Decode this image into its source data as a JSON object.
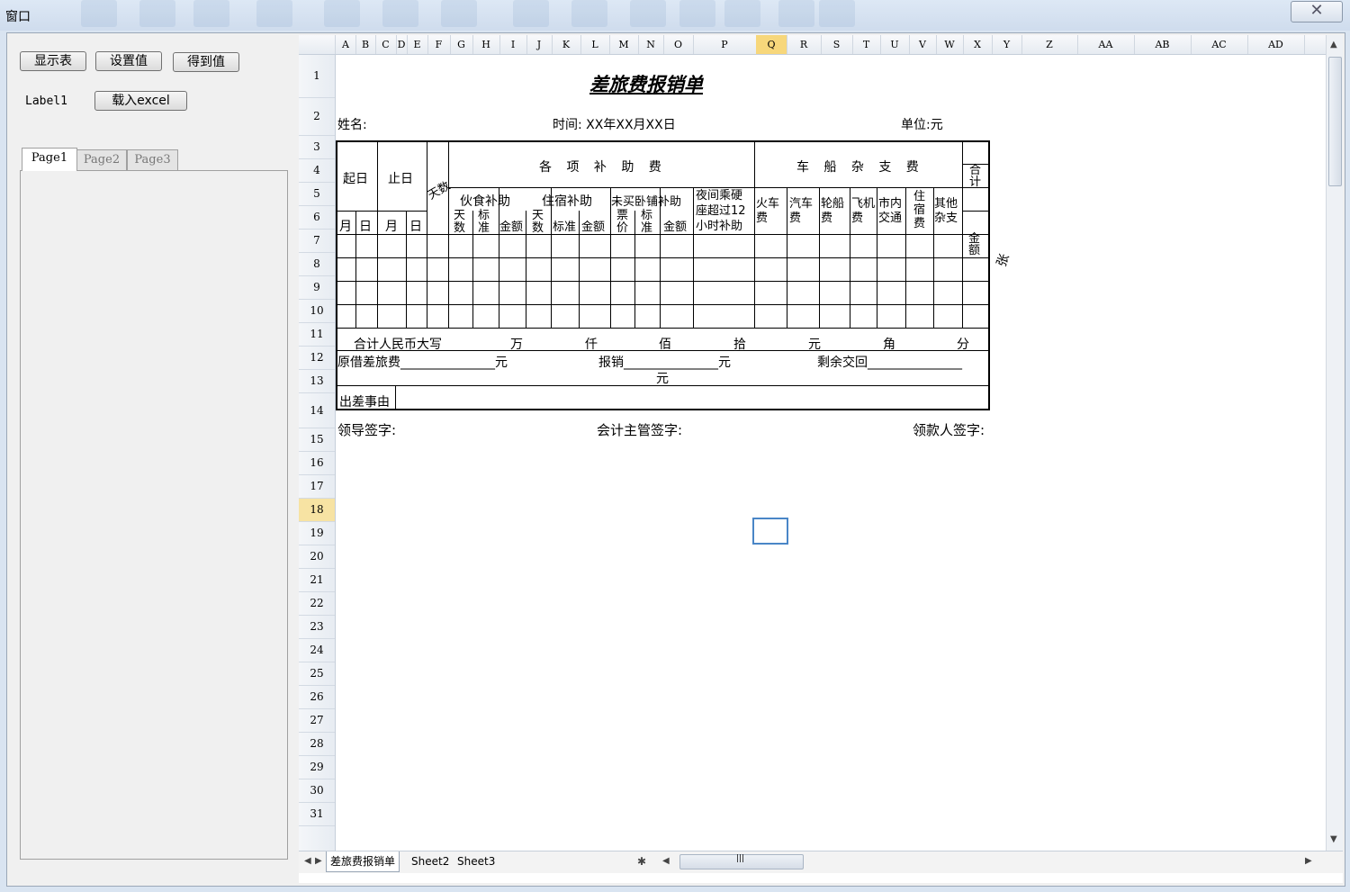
{
  "window": {
    "title": "窗口",
    "close_symbol": "✕"
  },
  "toolbar": {
    "show_table": "显示表",
    "set_value": "设置值",
    "get_value": "得到值",
    "label1": "Label1",
    "load_excel": "载入excel"
  },
  "tabs": [
    "Page1",
    "Page2",
    "Page3"
  ],
  "spreadsheet": {
    "columns": [
      "A",
      "B",
      "C",
      "D",
      "E",
      "F",
      "G",
      "H",
      "I",
      "J",
      "K",
      "L",
      "M",
      "N",
      "O",
      "P",
      "Q",
      "R",
      "S",
      "T",
      "U",
      "V",
      "W",
      "X",
      "Y",
      "Z",
      "AA",
      "AB",
      "AC",
      "AD"
    ],
    "selected_column": "Q",
    "rows": [
      "1",
      "2",
      "3",
      "4",
      "5",
      "6",
      "7",
      "8",
      "9",
      "10",
      "11",
      "12",
      "13",
      "14",
      "15",
      "16",
      "17",
      "18",
      "19",
      "20",
      "21",
      "22",
      "23",
      "24",
      "25",
      "26",
      "27",
      "28",
      "29",
      "30",
      "31"
    ],
    "selected_row": "18",
    "form": {
      "title": "差旅费报销单",
      "name_label": "姓名:",
      "time_label": "时间: XX年XX月XX日",
      "unit_label": "单位:元",
      "start_day": "起日",
      "end_day": "止日",
      "days_col": "天数",
      "subsidies": "各 项 补 助 费",
      "vehicle": "车 船 杂 支 费",
      "total": "合计",
      "meal": "伙食补助",
      "lodging": "住宿补助",
      "sleeper": "未买卧铺补助",
      "night": "夜间乘硬座超过12小时补助",
      "days": "天数",
      "standard": "标准",
      "amount": "金额",
      "ticket_price": "票价",
      "month": "月",
      "day": "日",
      "train": "火车费",
      "bus": "汽车费",
      "ship": "轮船费",
      "plane": "飞机费",
      "city": "市内交通",
      "hotel": "住宿费",
      "other": "其他杂支",
      "amount_col": "金额",
      "attachment": "张",
      "sum_caps": "合计人民币大写",
      "wan": "万",
      "qian": "仟",
      "bai": "佰",
      "shi": "拾",
      "yuan": "元",
      "jiao": "角",
      "fen": "分",
      "advance": "原借差旅费_______________元",
      "reimburse": "报销_______________元",
      "remain": "剩余交回_______________",
      "remain_unit": "元",
      "reason": "出差事由",
      "leader_sign": "领导签字:",
      "accountant_sign": "会计主管签字:",
      "payee_sign": "领款人签字:"
    },
    "sheet_tabs": [
      "差旅费报销单",
      "Sheet2",
      "Sheet3"
    ],
    "active_sheet": "差旅费报销单",
    "scroll_glyph": "|||",
    "hscroll_left": "◀",
    "hscroll_right": "▶",
    "vscroll_up": "▲",
    "vscroll_down": "▼",
    "nav_prev": "◀",
    "nav_next": "▶",
    "star": "✱"
  }
}
